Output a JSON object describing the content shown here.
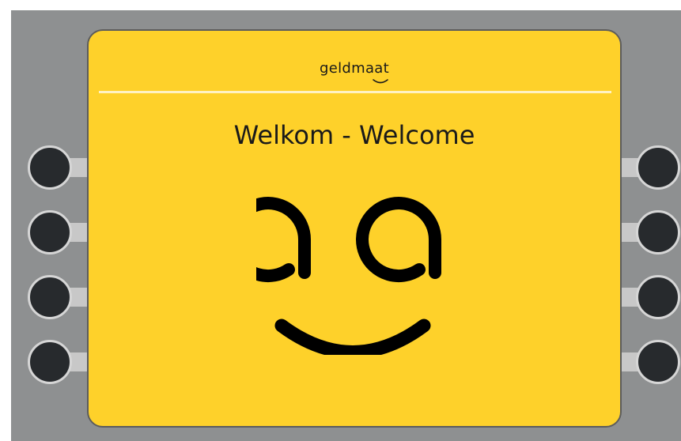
{
  "atm": {
    "brand_name": "geldmaat",
    "welcome_text": "Welkom - Welcome",
    "logo_icon": "geldmaat-smiley-logo-icon",
    "colors": {
      "screen_background": "#fed12a",
      "bezel": "#8e9091",
      "button": "#272a2d",
      "text": "#1a1a1a"
    },
    "side_buttons": {
      "left": [
        "left-soft-key-1",
        "left-soft-key-2",
        "left-soft-key-3",
        "left-soft-key-4"
      ],
      "right": [
        "right-soft-key-1",
        "right-soft-key-2",
        "right-soft-key-3",
        "right-soft-key-4"
      ]
    }
  }
}
